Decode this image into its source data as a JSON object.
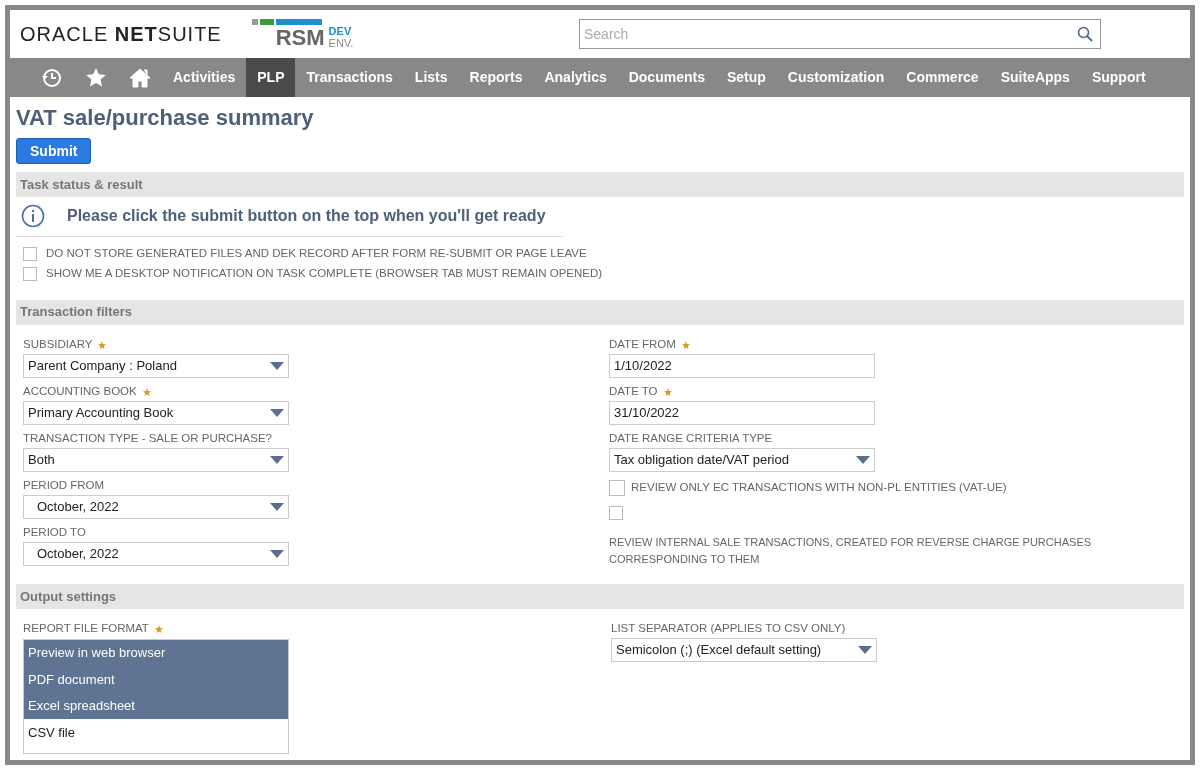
{
  "header": {
    "logo": "ORACLE **NET**SUITE",
    "brand": {
      "name": "RSM",
      "tag_top": "DEV",
      "tag_bottom": "ENV."
    },
    "search": {
      "placeholder": "Search"
    }
  },
  "nav": {
    "icons": [
      {
        "kind": "recent"
      },
      {
        "kind": "star"
      },
      {
        "kind": "home"
      }
    ],
    "items": [
      {
        "label": "Activities",
        "selected": false
      },
      {
        "label": "PLP",
        "selected": true
      },
      {
        "label": "Transactions",
        "selected": false
      },
      {
        "label": "Lists",
        "selected": false
      },
      {
        "label": "Reports",
        "selected": false
      },
      {
        "label": "Analytics",
        "selected": false
      },
      {
        "label": "Documents",
        "selected": false
      },
      {
        "label": "Setup",
        "selected": false
      },
      {
        "label": "Customization",
        "selected": false
      },
      {
        "label": "Commerce",
        "selected": false
      },
      {
        "label": "SuiteApps",
        "selected": false
      },
      {
        "label": "Support",
        "selected": false
      }
    ]
  },
  "page_title": "VAT sale/purchase summary",
  "submit_button": "Submit",
  "task_status": {
    "title": "Task status & result",
    "message": "Please click the submit button on the top when you'll get ready",
    "checkboxes": [
      {
        "label": "DO NOT STORE GENERATED FILES AND DEK RECORD AFTER FORM RE-SUBMIT OR PAGE LEAVE",
        "checked": false
      },
      {
        "label": "SHOW ME A DESKTOP NOTIFICATION ON TASK COMPLETE (BROWSER TAB MUST REMAIN OPENED)",
        "checked": false
      }
    ]
  },
  "transaction_filters": {
    "title": "Transaction filters",
    "left": [
      {
        "kind": "select",
        "label": "SUBSIDIARY",
        "required": true,
        "value": "Parent Company : Poland"
      },
      {
        "kind": "select",
        "label": "ACCOUNTING BOOK",
        "required": true,
        "value": "Primary Accounting Book"
      },
      {
        "kind": "select",
        "label": "TRANSACTION TYPE - SALE OR PURCHASE?",
        "required": false,
        "value": "Both"
      },
      {
        "kind": "select",
        "label": "PERIOD FROM",
        "required": false,
        "value": "October, 2022",
        "indented": true
      },
      {
        "kind": "select",
        "label": "PERIOD TO",
        "required": false,
        "value": "October, 2022",
        "indented": true
      }
    ],
    "right": [
      {
        "kind": "text",
        "label": "DATE FROM",
        "required": true,
        "value": "1/10/2022"
      },
      {
        "kind": "text",
        "label": "DATE TO",
        "required": true,
        "value": "31/10/2022"
      },
      {
        "kind": "select",
        "label": "DATE RANGE CRITERIA TYPE",
        "required": false,
        "value": "Tax obligation date/VAT period"
      },
      {
        "kind": "checkbox",
        "label": "REVIEW ONLY EC TRANSACTIONS WITH NON-PL ENTITIES (VAT-UE)",
        "checked": false
      },
      {
        "kind": "checkbox_stacked",
        "label": "REVIEW INTERNAL SALE TRANSACTIONS, CREATED FOR REVERSE CHARGE PURCHASES CORRESPONDING TO THEM",
        "checked": false
      }
    ]
  },
  "output_settings": {
    "title": "Output settings",
    "report_file_format": {
      "label": "REPORT FILE FORMAT",
      "required": true,
      "options": [
        {
          "label": "Preview in web browser",
          "selected": true
        },
        {
          "label": "PDF document",
          "selected": true
        },
        {
          "label": "Excel spreadsheet",
          "selected": true
        },
        {
          "label": "CSV file",
          "selected": false
        }
      ]
    },
    "list_separator": {
      "label": "LIST SEPARATOR (APPLIES TO CSV ONLY)",
      "required": false,
      "value": "Semicolon (;) (Excel default setting)"
    }
  }
}
